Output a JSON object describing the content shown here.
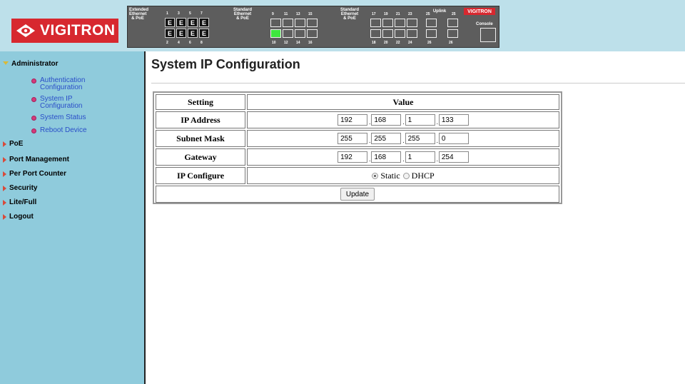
{
  "header": {
    "brand": "VIGITRON",
    "panel": {
      "extended_label": "Extended Ethernet & PoE",
      "std_label_1": "Standard Ethernet & PoE",
      "std_label_2": "Standard Ethernet & PoE",
      "uplink_label": "Uplink",
      "console_label": "Console",
      "mini_brand": "VIGITRON",
      "top_numbers": [
        "1",
        "3",
        "5",
        "7",
        "9",
        "11",
        "13",
        "15",
        "17",
        "19",
        "21",
        "23",
        "25",
        "25"
      ],
      "bottom_numbers": [
        "2",
        "4",
        "6",
        "8",
        "10",
        "12",
        "14",
        "16",
        "18",
        "20",
        "22",
        "24",
        "26",
        "26"
      ],
      "eport_glyph": "E"
    }
  },
  "sidebar": {
    "sections": [
      {
        "label": "Administrator",
        "expanded": true
      },
      {
        "label": "PoE"
      },
      {
        "label": "Port Management"
      },
      {
        "label": "Per Port Counter"
      },
      {
        "label": "Security"
      },
      {
        "label": "Lite/Full"
      },
      {
        "label": "Logout"
      }
    ],
    "admin_items": [
      "Authentication Configuration",
      "System IP Configuration",
      "System Status",
      "Reboot Device"
    ]
  },
  "main": {
    "title": "System IP Configuration",
    "table": {
      "col_setting": "Setting",
      "col_value": "Value",
      "rows": [
        {
          "label": "IP Address",
          "octets": [
            "192",
            "168",
            "1",
            "133"
          ]
        },
        {
          "label": "Subnet Mask",
          "octets": [
            "255",
            "255",
            "255",
            "0"
          ]
        },
        {
          "label": "Gateway",
          "octets": [
            "192",
            "168",
            "1",
            "254"
          ]
        }
      ],
      "ip_configure_label": "IP Configure",
      "static_label": "Static",
      "dhcp_label": "DHCP",
      "selected": "Static",
      "update_label": "Update"
    }
  },
  "colors": {
    "header_bg": "#bde0ea",
    "sidebar_bg": "#8fcbdc",
    "brand_red": "#d7282f",
    "link_blue": "#2a4ec8"
  }
}
